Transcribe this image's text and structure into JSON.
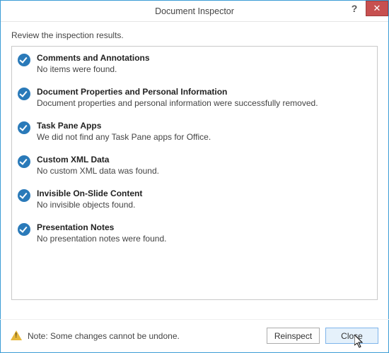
{
  "titlebar": {
    "title": "Document Inspector",
    "help_symbol": "?",
    "close_symbol": "✕"
  },
  "instruction": "Review the inspection results.",
  "results": [
    {
      "title": "Comments and Annotations",
      "desc": "No items were found."
    },
    {
      "title": "Document Properties and Personal Information",
      "desc": "Document properties and personal information were successfully removed."
    },
    {
      "title": "Task Pane Apps",
      "desc": "We did not find any Task Pane apps for Office."
    },
    {
      "title": "Custom XML Data",
      "desc": "No custom XML data was found."
    },
    {
      "title": "Invisible On-Slide Content",
      "desc": "No invisible objects found."
    },
    {
      "title": "Presentation Notes",
      "desc": "No presentation notes were found."
    }
  ],
  "footer": {
    "note": "Note: Some changes cannot be undone.",
    "reinspect_label": "Reinspect",
    "close_label": "Close"
  }
}
